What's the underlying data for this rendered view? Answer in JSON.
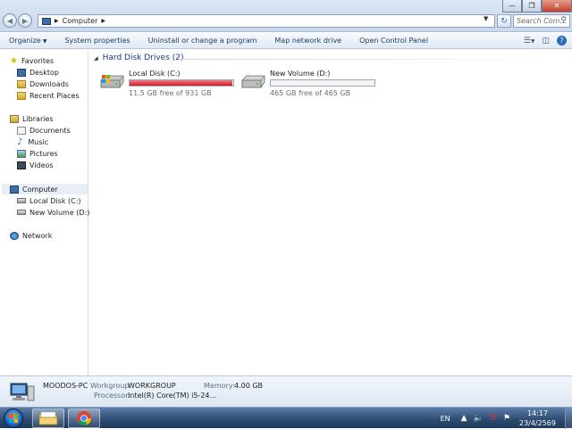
{
  "address": {
    "path": [
      "Computer"
    ],
    "search_placeholder": "Search Com..."
  },
  "toolbar": {
    "items": [
      "Organize",
      "System properties",
      "Uninstall or change a program",
      "Map network drive",
      "Open Control Panel"
    ]
  },
  "nav": {
    "favorites": "Favorites",
    "desktop": "Desktop",
    "downloads": "Downloads",
    "recent": "Recent Places",
    "libraries": "Libraries",
    "documents": "Documents",
    "music": "Music",
    "pictures": "Pictures",
    "videos": "Videos",
    "computer": "Computer",
    "local_disk": "Local Disk (C:)",
    "new_volume": "New Volume (D:)",
    "network": "Network"
  },
  "content": {
    "group_title": "Hard Disk Drives (2)",
    "drives": [
      {
        "name": "Local Disk (C:)",
        "free_text": "11.5 GB free of 931 GB",
        "used_fraction": 0.988,
        "critical": true
      },
      {
        "name": "New Volume (D:)",
        "free_text": "465 GB free of 465 GB",
        "used_fraction": 0.0,
        "critical": false
      }
    ]
  },
  "details": {
    "computer_name": "MOODOS-PC",
    "workgroup_label": "Workgroup:",
    "workgroup_value": "WORKGROUP",
    "memory_label": "Memory:",
    "memory_value": "4.00 GB",
    "processor_label": "Processor:",
    "processor_value": "Intel(R) Core(TM) i5-24..."
  },
  "taskbar": {
    "language": "EN",
    "time": "14:17",
    "date": "23/4/2569"
  },
  "colors": {
    "critical_bar": "#d2182a",
    "normal_bar": "#2a8bd6",
    "group_header": "#1e3287"
  }
}
